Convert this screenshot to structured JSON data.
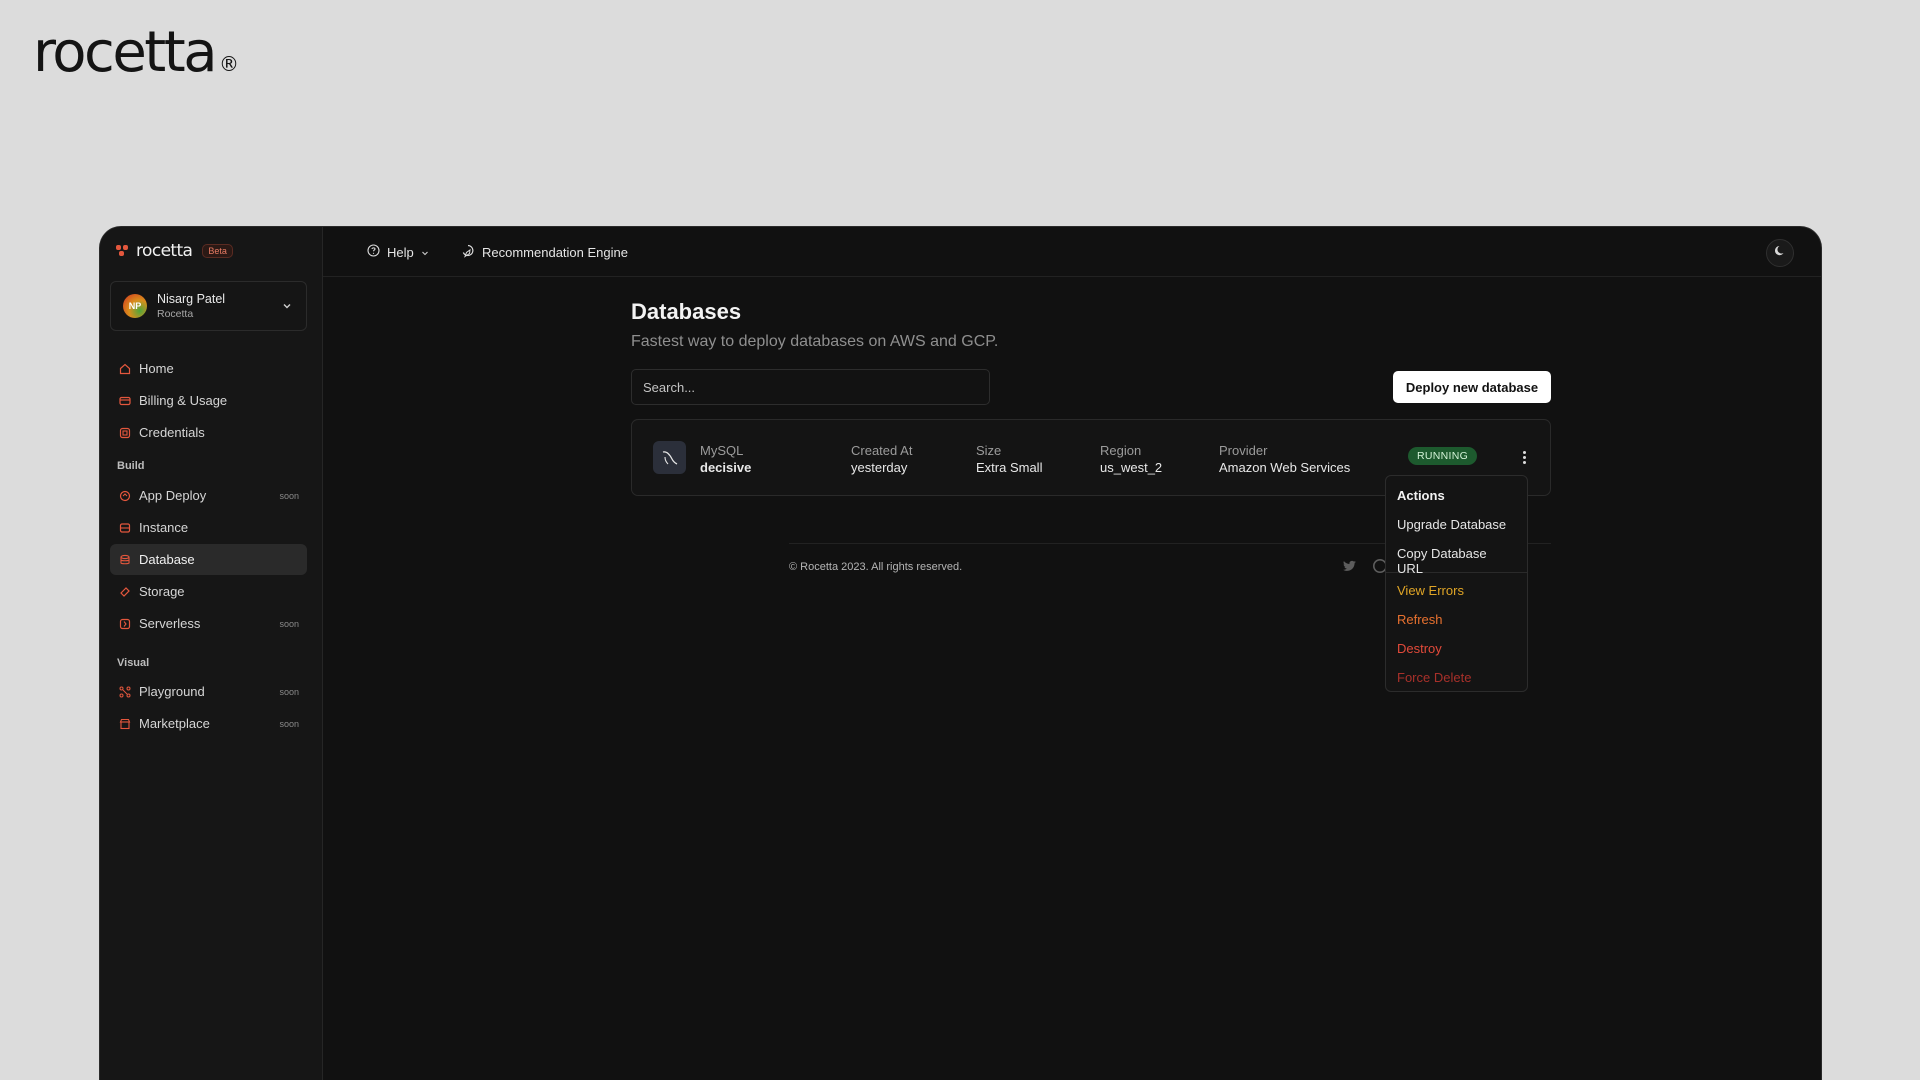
{
  "brand": {
    "name": "rocetta",
    "registered": "®"
  },
  "app": {
    "logo_text": "rocetta",
    "beta_badge": "Beta",
    "brand_color": "#e4573d"
  },
  "profile": {
    "initials": "NP",
    "name": "Nisarg Patel",
    "org": "Rocetta"
  },
  "sidebar": {
    "items": [
      {
        "label": "Home",
        "icon": "home-icon"
      },
      {
        "label": "Billing & Usage",
        "icon": "billing-icon"
      },
      {
        "label": "Credentials",
        "icon": "credentials-icon"
      }
    ],
    "sections": [
      {
        "title": "Build",
        "items": [
          {
            "label": "App Deploy",
            "soon": "soon",
            "icon": "app-deploy-icon"
          },
          {
            "label": "Instance",
            "icon": "instance-icon"
          },
          {
            "label": "Database",
            "icon": "database-icon",
            "active": true
          },
          {
            "label": "Storage",
            "icon": "storage-icon"
          },
          {
            "label": "Serverless",
            "soon": "soon",
            "icon": "serverless-icon"
          }
        ]
      },
      {
        "title": "Visual",
        "items": [
          {
            "label": "Playground",
            "soon": "soon",
            "icon": "playground-icon"
          },
          {
            "label": "Marketplace",
            "soon": "soon",
            "icon": "marketplace-icon"
          }
        ]
      }
    ]
  },
  "topbar": {
    "help": "Help",
    "recommendation": "Recommendation Engine"
  },
  "page": {
    "title": "Databases",
    "subtitle": "Fastest way to deploy databases on AWS and GCP.",
    "search_placeholder": "Search...",
    "deploy_button": "Deploy new database"
  },
  "database": {
    "engine": "MySQL",
    "name": "decisive",
    "created_label": "Created At",
    "created_value": "yesterday",
    "size_label": "Size",
    "size_value": "Extra Small",
    "region_label": "Region",
    "region_value": "us_west_2",
    "provider_label": "Provider",
    "provider_value": "Amazon Web Services",
    "status": "RUNNING",
    "status_color": "#1d5a2e"
  },
  "footer": {
    "copyright": "© Rocetta 2023. All rights reserved."
  },
  "actions_menu": {
    "title": "Actions",
    "items": [
      {
        "label": "Upgrade Database",
        "color": "#e6e6e6"
      },
      {
        "label": "Copy Database URL",
        "color": "#e6e6e6"
      }
    ],
    "danger_items": [
      {
        "label": "View Errors",
        "color": "#e0a526"
      },
      {
        "label": "Refresh",
        "color": "#e8712f"
      },
      {
        "label": "Destroy",
        "color": "#e24a3a"
      },
      {
        "label": "Force Delete",
        "color": "#a8302a"
      }
    ]
  }
}
